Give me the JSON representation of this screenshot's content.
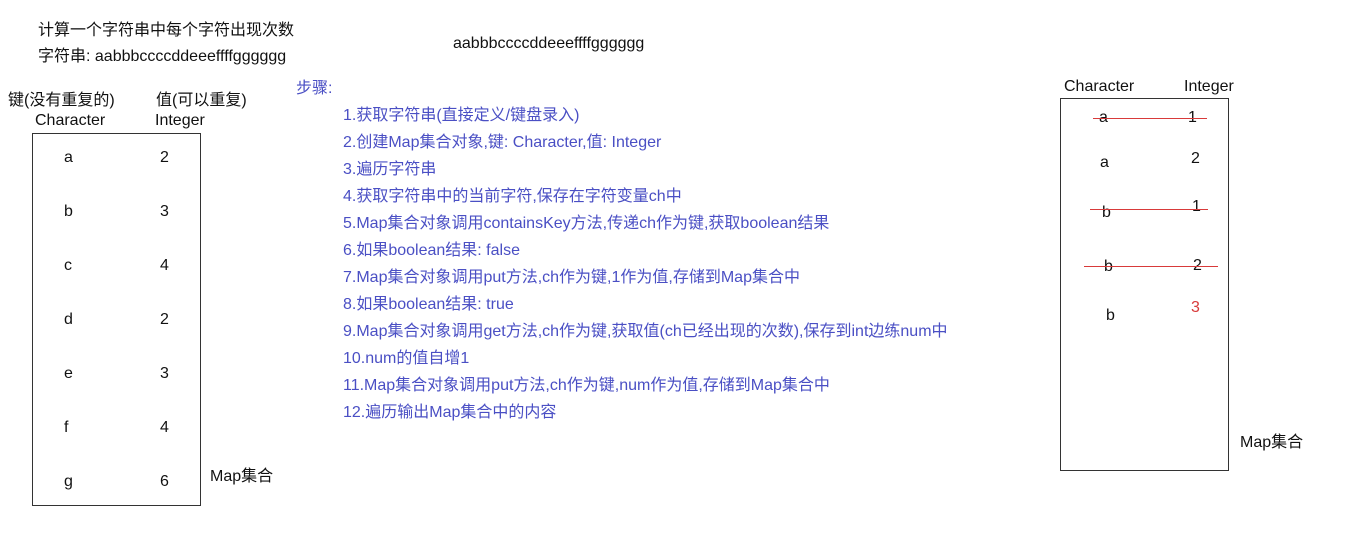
{
  "header": {
    "title": "计算一个字符串中每个字符出现次数",
    "string_line": "字符串: aabbbccccddeeeffffgggggg",
    "center_string": "aabbbccccddeeeffffgggggg"
  },
  "left": {
    "key_header": "键(没有重复的)",
    "value_header": "值(可以重复)",
    "key_type": "Character",
    "value_type": "Integer",
    "rows": [
      {
        "k": "a",
        "v": "2"
      },
      {
        "k": "b",
        "v": "3"
      },
      {
        "k": "c",
        "v": "4"
      },
      {
        "k": "d",
        "v": "2"
      },
      {
        "k": "e",
        "v": "3"
      },
      {
        "k": "f",
        "v": "4"
      },
      {
        "k": "g",
        "v": "6"
      }
    ],
    "map_label": "Map集合"
  },
  "steps": {
    "label": "步骤:",
    "items": [
      "1.获取字符串(直接定义/键盘录入)",
      "2.创建Map集合对象,键: Character,值: Integer",
      "3.遍历字符串",
      "4.获取字符串中的当前字符,保存在字符变量ch中",
      "5.Map集合对象调用containsKey方法,传递ch作为键,获取boolean结果",
      "6.如果boolean结果: false",
      "7.Map集合对象调用put方法,ch作为键,1作为值,存储到Map集合中",
      "8.如果boolean结果: true",
      "9.Map集合对象调用get方法,ch作为键,获取值(ch已经出现的次数),保存到int边练num中",
      "10.num的值自增1",
      "11.Map集合对象调用put方法,ch作为键,num作为值,存储到Map集合中",
      "12.遍历输出Map集合中的内容"
    ],
    "color": "#4a4fc4"
  },
  "right": {
    "key_type": "Character",
    "value_type": "Integer",
    "rows": [
      {
        "k": "a",
        "v": "1",
        "struck": true
      },
      {
        "k": "a",
        "v": "2",
        "struck": false
      },
      {
        "k": "b",
        "v": "1",
        "struck": true
      },
      {
        "k": "b",
        "v": "2",
        "struck": true
      },
      {
        "k": "b",
        "v": "3",
        "struck": false,
        "value_color": "#d83a3a"
      }
    ],
    "map_label": "Map集合",
    "strike_color": "#d83a3a"
  }
}
